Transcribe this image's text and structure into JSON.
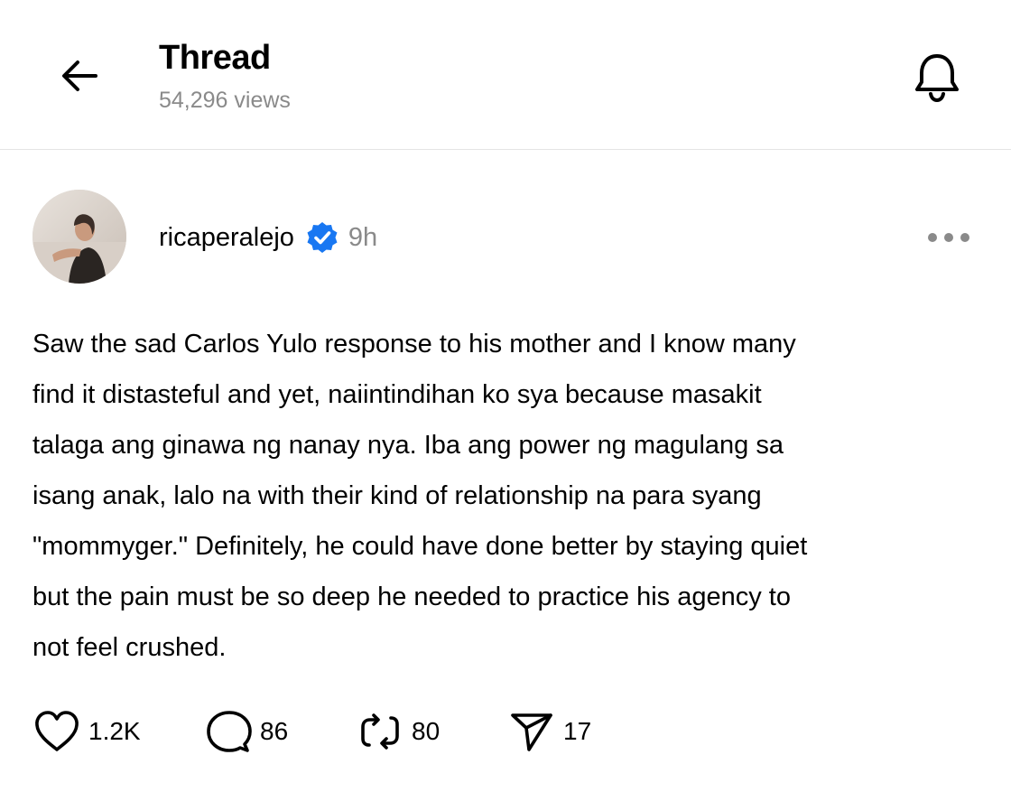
{
  "header": {
    "title": "Thread",
    "views": "54,296 views",
    "back_icon": "back-arrow-icon",
    "notification_icon": "bell-icon"
  },
  "post": {
    "username": "ricaperalejo",
    "verified": true,
    "verified_color": "#1877f2",
    "timestamp": "9h",
    "body": "Saw the sad Carlos Yulo response to his mother and I know many\nfind it distasteful and yet, naiintindihan ko sya because masakit\ntalaga ang ginawa ng nanay nya. Iba ang power ng magulang sa\nisang anak, lalo na with their kind of relationship na para syang\n\"mommyger.\" Definitely, he could have done better by staying quiet\nbut the pain must be so deep he needed to practice his agency to\nnot feel crushed.",
    "actions": {
      "likes": "1.2K",
      "replies": "86",
      "reposts": "80",
      "shares": "17"
    }
  }
}
